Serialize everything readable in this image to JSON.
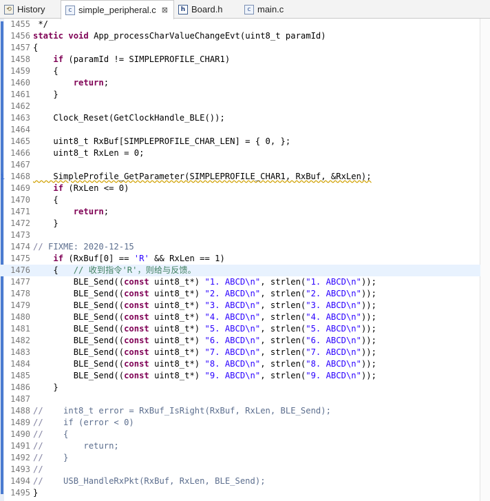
{
  "tabs": [
    {
      "label": "History",
      "icon": "history-icon"
    },
    {
      "label": "simple_peripheral.c",
      "icon": "c-file-icon",
      "close": "⊠"
    },
    {
      "label": "Board.h",
      "icon": "h-file-icon"
    },
    {
      "label": "main.c",
      "icon": "c-file-icon"
    }
  ],
  "editor": {
    "current_line": 1476,
    "lines": [
      {
        "n": "1455",
        "t": " */"
      },
      {
        "n": "1456",
        "t": "static void App_processCharValueChangeEvt(uint8_t paramId)"
      },
      {
        "n": "1457",
        "t": "{"
      },
      {
        "n": "1458",
        "t": "    if (paramId != SIMPLEPROFILE_CHAR1)"
      },
      {
        "n": "1459",
        "t": "    {"
      },
      {
        "n": "1460",
        "t": "        return;"
      },
      {
        "n": "1461",
        "t": "    }"
      },
      {
        "n": "1462",
        "t": ""
      },
      {
        "n": "1463",
        "t": "    Clock_Reset(GetClockHandle_BLE());"
      },
      {
        "n": "1464",
        "t": ""
      },
      {
        "n": "1465",
        "t": "    uint8_t RxBuf[SIMPLEPROFILE_CHAR_LEN] = { 0, };"
      },
      {
        "n": "1466",
        "t": "    uint8_t RxLen = 0;"
      },
      {
        "n": "1467",
        "t": ""
      },
      {
        "n": "1468",
        "t": "    SimpleProfile_GetParameter(SIMPLEPROFILE_CHAR1, RxBuf, &RxLen);"
      },
      {
        "n": "1469",
        "t": "    if (RxLen <= 0)"
      },
      {
        "n": "1470",
        "t": "    {"
      },
      {
        "n": "1471",
        "t": "        return;"
      },
      {
        "n": "1472",
        "t": "    }"
      },
      {
        "n": "1473",
        "t": ""
      },
      {
        "n": "1474",
        "t": "    // FIXME: 2020-12-15"
      },
      {
        "n": "1475",
        "t": "    if (RxBuf[0] == 'R' && RxLen == 1)"
      },
      {
        "n": "1476",
        "t": "    {   // 收到指令'R'，则给与反馈。"
      },
      {
        "n": "1477",
        "t": "        BLE_Send((const uint8_t*) \"1. ABCD\\n\", strlen(\"1. ABCD\\n\"));"
      },
      {
        "n": "1478",
        "t": "        BLE_Send((const uint8_t*) \"2. ABCD\\n\", strlen(\"2. ABCD\\n\"));"
      },
      {
        "n": "1479",
        "t": "        BLE_Send((const uint8_t*) \"3. ABCD\\n\", strlen(\"3. ABCD\\n\"));"
      },
      {
        "n": "1480",
        "t": "        BLE_Send((const uint8_t*) \"4. ABCD\\n\", strlen(\"4. ABCD\\n\"));"
      },
      {
        "n": "1481",
        "t": "        BLE_Send((const uint8_t*) \"5. ABCD\\n\", strlen(\"5. ABCD\\n\"));"
      },
      {
        "n": "1482",
        "t": "        BLE_Send((const uint8_t*) \"6. ABCD\\n\", strlen(\"6. ABCD\\n\"));"
      },
      {
        "n": "1483",
        "t": "        BLE_Send((const uint8_t*) \"7. ABCD\\n\", strlen(\"7. ABCD\\n\"));"
      },
      {
        "n": "1484",
        "t": "        BLE_Send((const uint8_t*) \"8. ABCD\\n\", strlen(\"8. ABCD\\n\"));"
      },
      {
        "n": "1485",
        "t": "        BLE_Send((const uint8_t*) \"9. ABCD\\n\", strlen(\"9. ABCD\\n\"));"
      },
      {
        "n": "1486",
        "t": "    }"
      },
      {
        "n": "1487",
        "t": ""
      },
      {
        "n": "1488",
        "t": "//    int8_t error = RxBuf_IsRight(RxBuf, RxLen, BLE_Send);"
      },
      {
        "n": "1489",
        "t": "//    if (error < 0)"
      },
      {
        "n": "1490",
        "t": "//    {"
      },
      {
        "n": "1491",
        "t": "//        return;"
      },
      {
        "n": "1492",
        "t": "//    }"
      },
      {
        "n": "1493",
        "t": "//"
      },
      {
        "n": "1494",
        "t": "//    USB_HandleRxPkt(RxBuf, RxLen, BLE_Send);"
      },
      {
        "n": "1495",
        "t": "}"
      }
    ]
  },
  "colors": {
    "keyword": "#7f0055",
    "string": "#2a00ff",
    "comment": "#3f7f5f",
    "current_line": "#e8f2fe"
  }
}
